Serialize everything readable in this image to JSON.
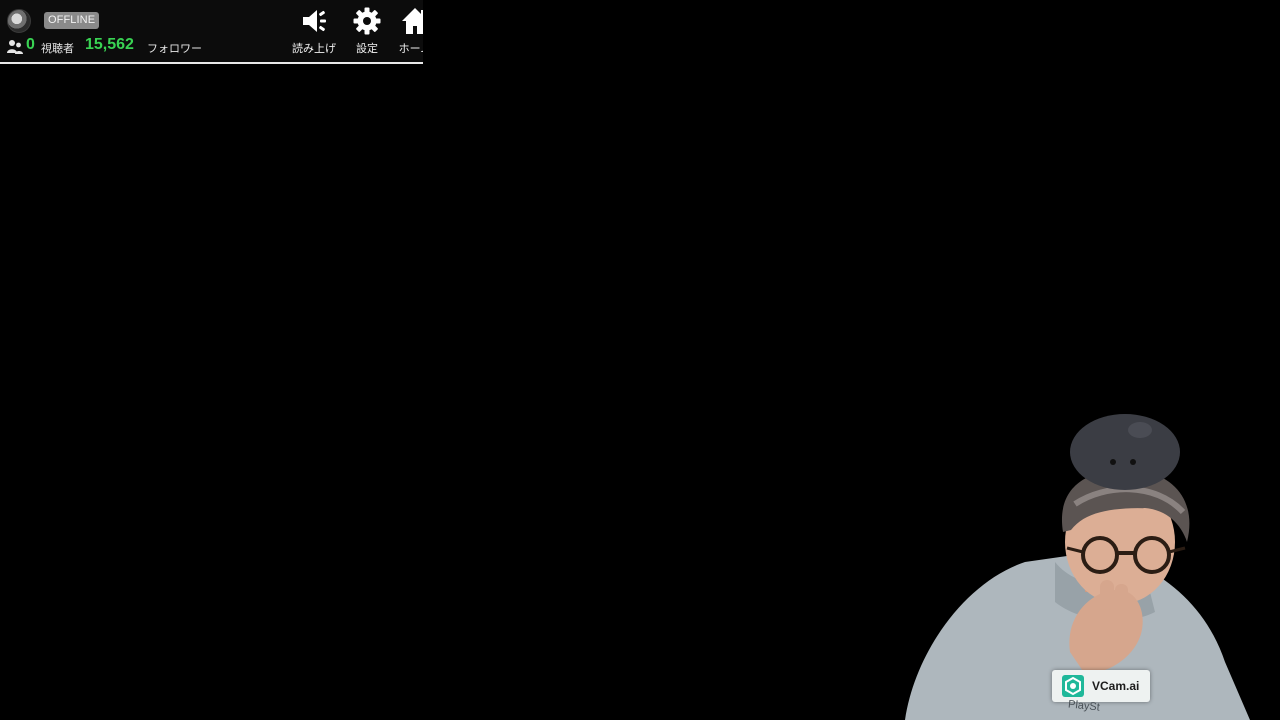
{
  "header": {
    "status": "OFFLINE",
    "viewers": {
      "count": "0",
      "label": "視聴者"
    },
    "followers": {
      "count": "15,562",
      "label": "フォロワー"
    },
    "tools": [
      {
        "label": "読み上げ",
        "icon": "speaker-icon"
      },
      {
        "label": "設定",
        "icon": "gear-icon"
      },
      {
        "label": "ホーム",
        "icon": "home-icon"
      }
    ]
  },
  "overlay": {
    "vcam_label": "VCam.ai",
    "shirt_text": "PlaySt"
  },
  "colors": {
    "background": "#000000",
    "panel": "#0c0c0c",
    "accent_green": "#39d353",
    "badge_gray": "#8a8a8a",
    "vcam_teal": "#1fb89a"
  }
}
